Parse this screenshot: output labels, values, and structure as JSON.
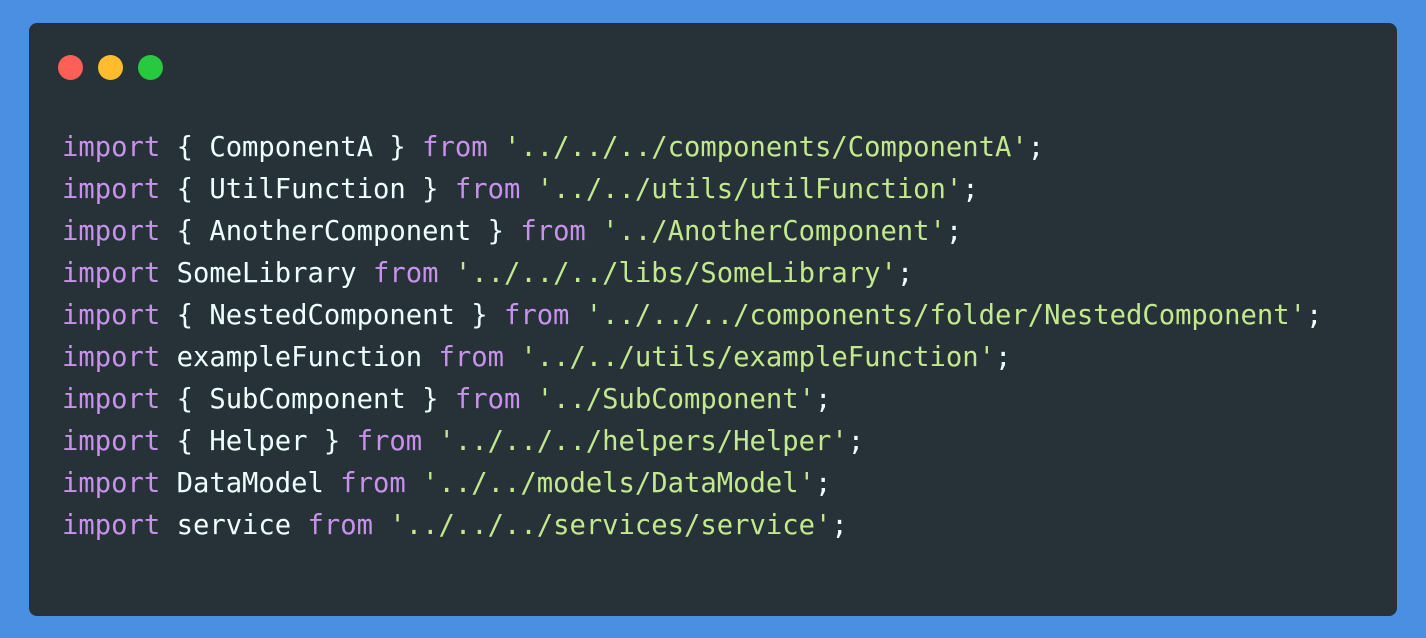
{
  "colors": {
    "background": "#4a8fe2",
    "window_bg": "#263238",
    "keyword": "#c792ea",
    "identifier": "#eeffff",
    "string": "#c3e88d",
    "punctuation": "#eeffff",
    "dot_red": "#ff5f56",
    "dot_yellow": "#ffbd2e",
    "dot_green": "#27c93f"
  },
  "window": {
    "controls": [
      "close",
      "minimize",
      "maximize"
    ]
  },
  "code_lines": [
    {
      "kw": "import",
      "mid": " { ComponentA } ",
      "from": "from",
      "str": " '../../../components/ComponentA'",
      "end": ";"
    },
    {
      "kw": "import",
      "mid": " { UtilFunction } ",
      "from": "from",
      "str": " '../../utils/utilFunction'",
      "end": ";"
    },
    {
      "kw": "import",
      "mid": " { AnotherComponent } ",
      "from": "from",
      "str": " '../AnotherComponent'",
      "end": ";"
    },
    {
      "kw": "import",
      "mid": " SomeLibrary ",
      "from": "from",
      "str": " '../../../libs/SomeLibrary'",
      "end": ";"
    },
    {
      "kw": "import",
      "mid": " { NestedComponent } ",
      "from": "from",
      "str": " '../../../components/folder/NestedComponent'",
      "end": ";"
    },
    {
      "kw": "import",
      "mid": " exampleFunction ",
      "from": "from",
      "str": " '../../utils/exampleFunction'",
      "end": ";"
    },
    {
      "kw": "import",
      "mid": " { SubComponent } ",
      "from": "from",
      "str": " '../SubComponent'",
      "end": ";"
    },
    {
      "kw": "import",
      "mid": " { Helper } ",
      "from": "from",
      "str": " '../../../helpers/Helper'",
      "end": ";"
    },
    {
      "kw": "import",
      "mid": " DataModel ",
      "from": "from",
      "str": " '../../models/DataModel'",
      "end": ";"
    },
    {
      "kw": "import",
      "mid": " service ",
      "from": "from",
      "str": " '../../../services/service'",
      "end": ";"
    }
  ]
}
